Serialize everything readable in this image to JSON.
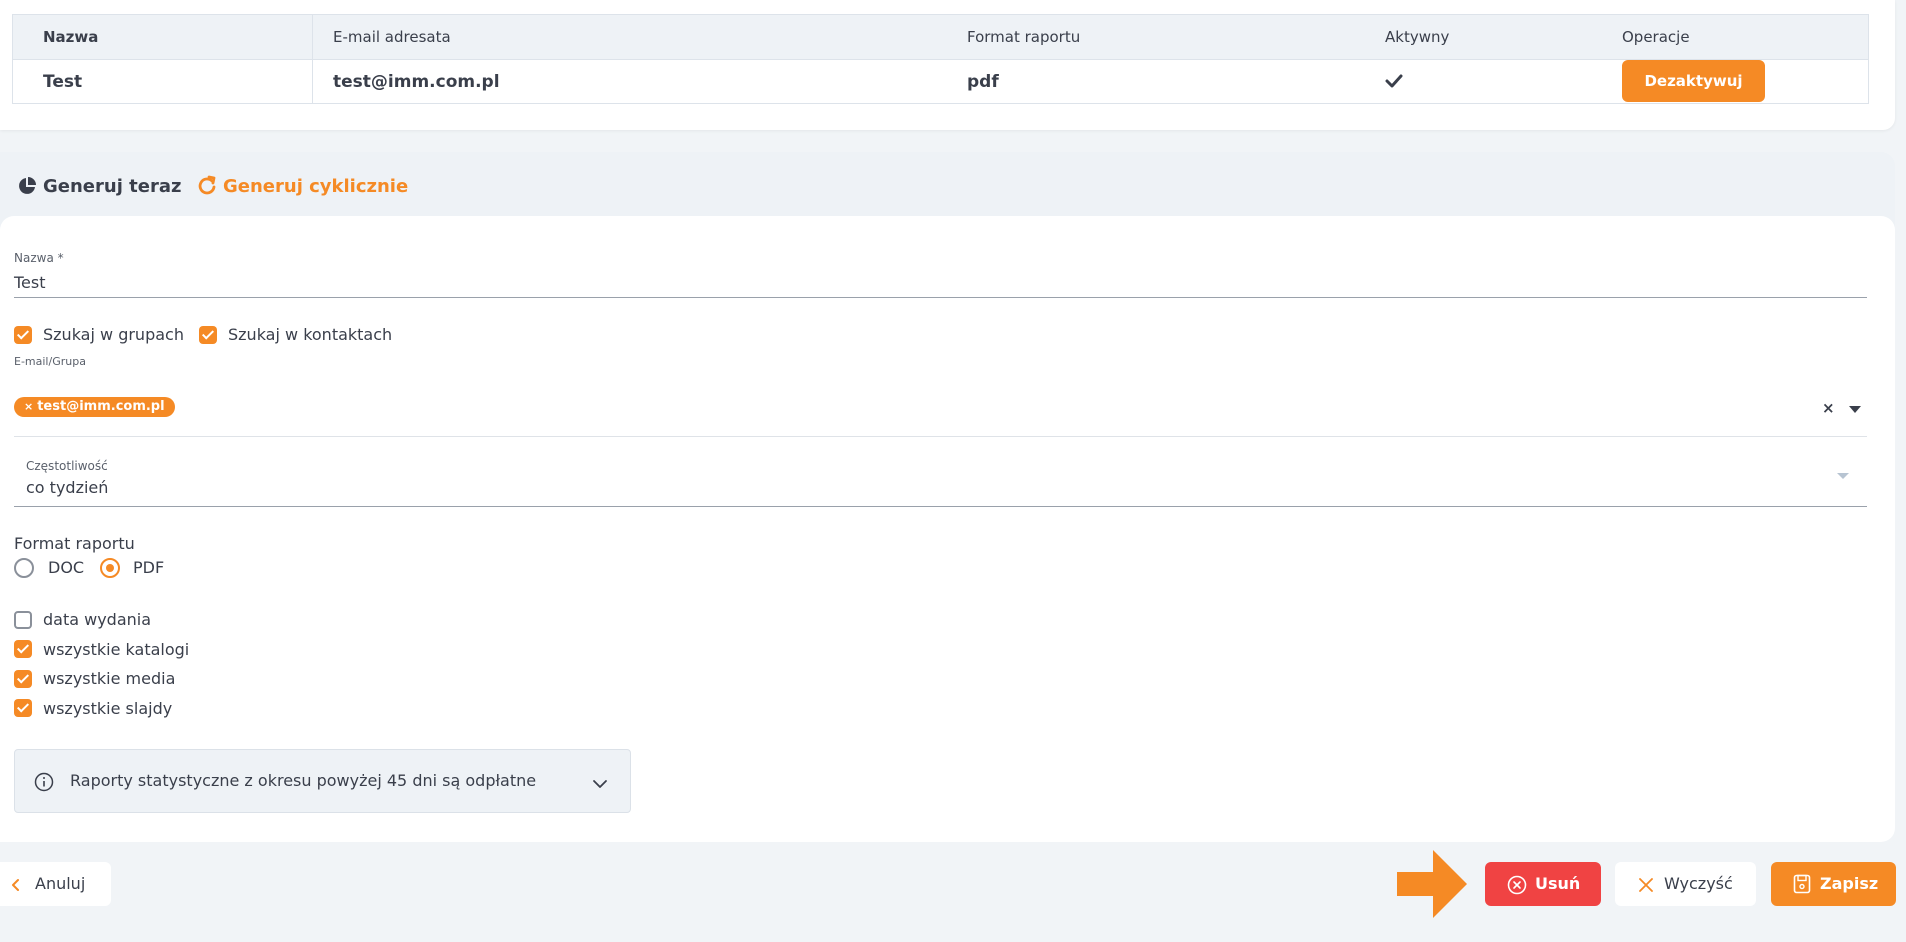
{
  "table": {
    "headers": [
      "Nazwa",
      "E-mail adresata",
      "Format raportu",
      "Aktywny",
      "Operacje"
    ],
    "rows": [
      {
        "name": "Test",
        "email": "test@imm.com.pl",
        "format": "pdf",
        "active_icon": "check-icon",
        "action": "Dezaktywuj"
      }
    ]
  },
  "tabs": {
    "now": {
      "label": "Generuj teraz",
      "icon": "pie-chart-icon"
    },
    "cyclic": {
      "label": "Generuj cyklicznie",
      "icon": "refresh-icon"
    }
  },
  "form": {
    "name_label": "Nazwa *",
    "name_value": "Test",
    "search_groups": "Szukaj w grupach",
    "search_contacts": "Szukaj w kontaktach",
    "email_group_label": "E-mail/Grupa",
    "chip_close": "×",
    "chip_value": "test@imm.com.pl",
    "clear_symbol": "×",
    "frequency_label": "Częstotliwość",
    "frequency_value": "co tydzień",
    "format_label": "Format raportu",
    "format_options": [
      "DOC",
      "PDF"
    ],
    "format_selected": "PDF",
    "options": [
      {
        "label": "data wydania",
        "checked": false
      },
      {
        "label": "wszystkie katalogi",
        "checked": true
      },
      {
        "label": "wszystkie media",
        "checked": true
      },
      {
        "label": "wszystkie slajdy",
        "checked": true
      }
    ],
    "info_text": "Raporty statystyczne z okresu powyżej 45 dni są odpłatne"
  },
  "footer": {
    "cancel": "Anuluj",
    "delete": "Usuń",
    "clear": "Wyczyść",
    "save": "Zapisz"
  },
  "colors": {
    "accent": "#f58a25",
    "danger": "#f04343",
    "text": "#3a3f4b"
  }
}
